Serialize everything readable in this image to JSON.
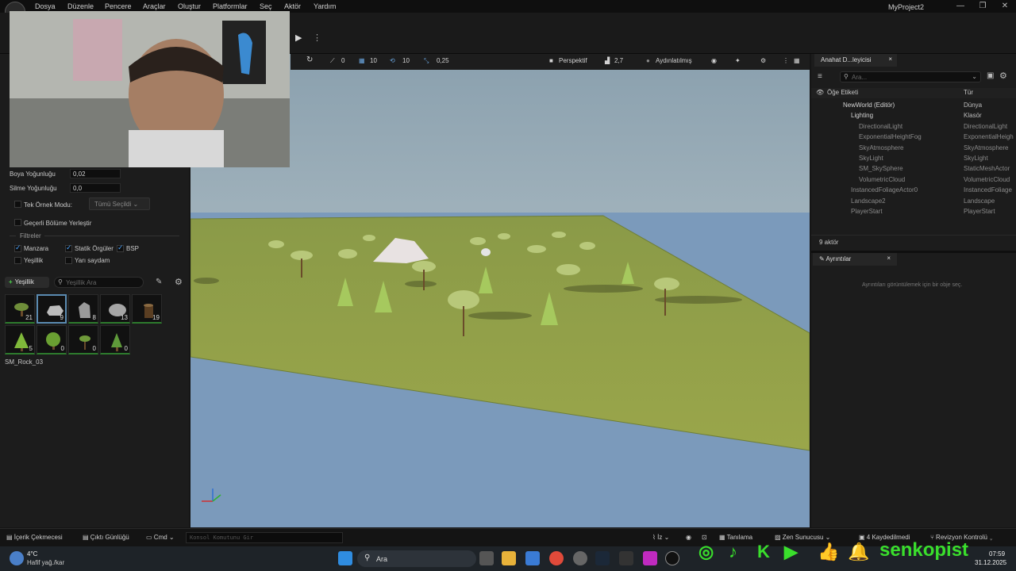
{
  "menu": [
    "Dosya",
    "Düzenle",
    "Pencere",
    "Araçlar",
    "Oluştur",
    "Platformlar",
    "Seç",
    "Aktör",
    "Yardım"
  ],
  "project_name": "MyProject2",
  "window_controls": [
    "—",
    "❐",
    "✕"
  ],
  "left_panel": {
    "paint_density_label": "Boya Yoğunluğu",
    "paint_density_value": "0,02",
    "erase_density_label": "Silme Yoğunluğu",
    "erase_density_value": "0,0",
    "single_instance_label": "Tek Örnek Modu:",
    "single_instance_dropdown": "Tümü Seçildi",
    "place_current_label": "Geçerli Bölüme Yerleştir",
    "filters_title": "Filtreler",
    "filters": [
      {
        "label": "Manzara",
        "checked": true
      },
      {
        "label": "Statik Örgüler",
        "checked": true
      },
      {
        "label": "BSP",
        "checked": true
      },
      {
        "label": "Yeşillik",
        "checked": false
      },
      {
        "label": "Yarı saydam",
        "checked": false
      }
    ],
    "add_foliage_label": "Yeşillik",
    "search_placeholder": "Yeşillik Ara",
    "tiles": [
      {
        "count": "21",
        "icon": "tree-icon"
      },
      {
        "count": "9",
        "icon": "rock-icon"
      },
      {
        "count": "8",
        "icon": "rock-icon"
      },
      {
        "count": "13",
        "icon": "rock-icon"
      },
      {
        "count": "19",
        "icon": "stump-icon"
      },
      {
        "count": "5",
        "icon": "pine-icon"
      },
      {
        "count": "0",
        "icon": "bush-icon"
      },
      {
        "count": "0",
        "icon": "tree-icon"
      },
      {
        "count": "0",
        "icon": "pine-icon"
      }
    ],
    "selected_asset": "SM_Rock_03"
  },
  "viewport_toolbar": {
    "snap_rotate": "0",
    "grid": "10",
    "rot": "10",
    "scale": "0,25",
    "perspective": "Perspektif",
    "camera_speed": "2,7",
    "lit": "Aydınlatılmış"
  },
  "outliner": {
    "tab_title": "Anahat D...leyicisi",
    "search_placeholder": "Ara...",
    "col_label": "Öğe Etiketi",
    "col_type": "Tür",
    "rows": [
      {
        "name": "NewWorld (Editör)",
        "type": "Dünya",
        "indent": 0,
        "dim": false
      },
      {
        "name": "Lighting",
        "type": "Klasör",
        "indent": 1,
        "dim": false
      },
      {
        "name": "DirectionalLight",
        "type": "DirectionalLight",
        "indent": 2,
        "dim": true
      },
      {
        "name": "ExponentialHeightFog",
        "type": "ExponentialHeigh",
        "indent": 2,
        "dim": true
      },
      {
        "name": "SkyAtmosphere",
        "type": "SkyAtmosphere",
        "indent": 2,
        "dim": true
      },
      {
        "name": "SkyLight",
        "type": "SkyLight",
        "indent": 2,
        "dim": true
      },
      {
        "name": "SM_SkySphere",
        "type": "StaticMeshActor",
        "indent": 2,
        "dim": true
      },
      {
        "name": "VolumetricCloud",
        "type": "VolumetricCloud",
        "indent": 2,
        "dim": true
      },
      {
        "name": "InstancedFoliageActor0",
        "type": "InstancedFoliage",
        "indent": 1,
        "dim": true
      },
      {
        "name": "Landscape2",
        "type": "Landscape",
        "indent": 1,
        "dim": true
      },
      {
        "name": "PlayerStart",
        "type": "PlayerStart",
        "indent": 1,
        "dim": true
      }
    ],
    "actor_count": "9 aktör"
  },
  "details": {
    "tab_title": "Ayrıntılar",
    "empty_message": "Ayrıntıları görüntülemek için bir obje seç."
  },
  "statusbar": {
    "content_drawer": "İçerik Çekmecesi",
    "output_log": "Çıktı Günlüğü",
    "cmd": "Cmd",
    "console_placeholder": "Konsol Komutunu Gir",
    "trace": "İz",
    "derived": "Tanılama",
    "zen": "Zen Sunucusu",
    "saved": "4 Kaydedilmedi",
    "revision": "Revizyon Kontrolü"
  },
  "taskbar": {
    "weather_temp": "4°C",
    "weather_desc": "Hafif yağ./kar",
    "search": "Ara",
    "time": "07:59",
    "date": "31.12.2025",
    "brand": "senkopist"
  }
}
